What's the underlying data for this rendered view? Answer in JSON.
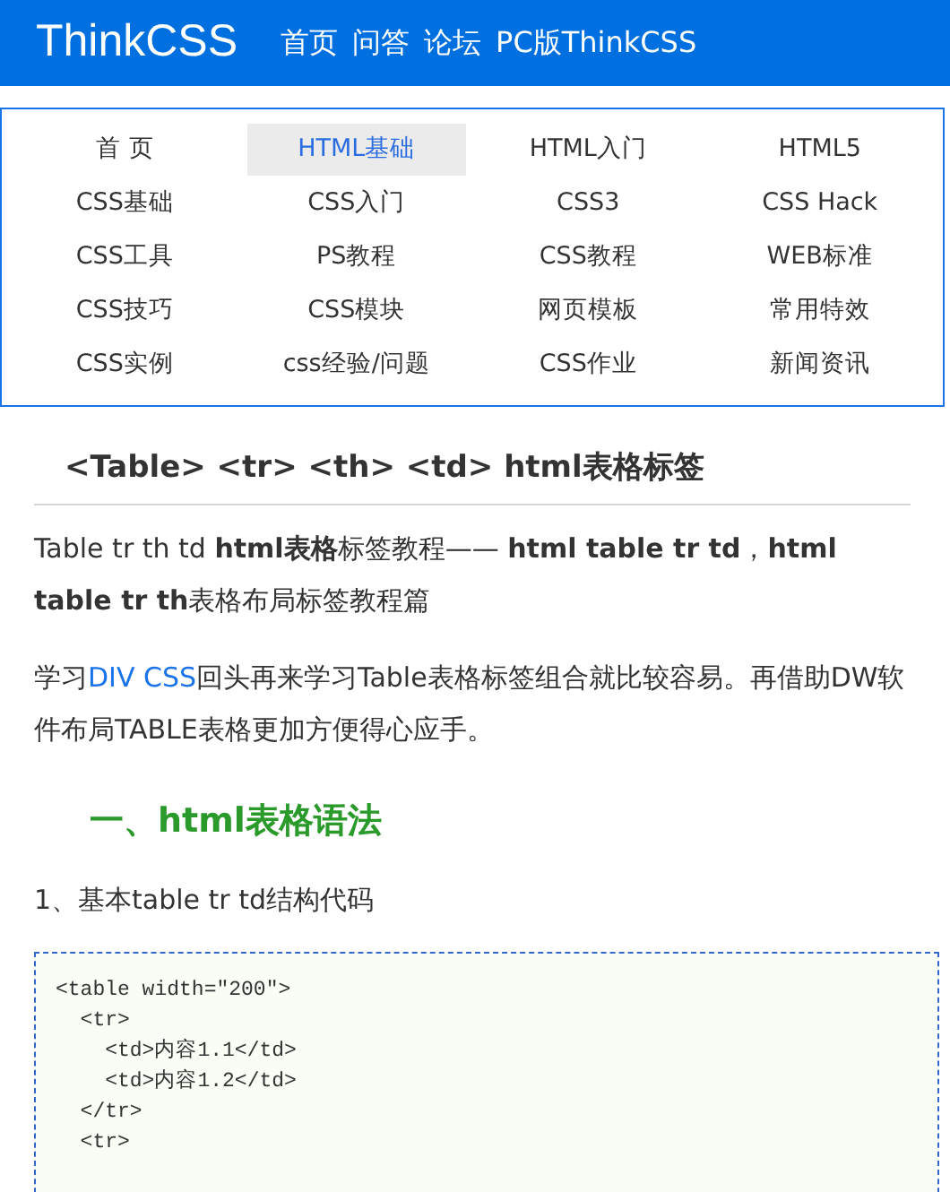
{
  "header": {
    "logo": "ThinkCSS",
    "links": [
      "首页",
      "问答",
      "论坛",
      "PC版ThinkCSS"
    ]
  },
  "category_nav": [
    {
      "label": "首 页",
      "selected": false
    },
    {
      "label": "HTML基础",
      "selected": true
    },
    {
      "label": "HTML入门",
      "selected": false
    },
    {
      "label": "HTML5",
      "selected": false
    },
    {
      "label": "CSS基础",
      "selected": false
    },
    {
      "label": "CSS入门",
      "selected": false
    },
    {
      "label": "CSS3",
      "selected": false
    },
    {
      "label": "CSS Hack",
      "selected": false
    },
    {
      "label": "CSS工具",
      "selected": false
    },
    {
      "label": "PS教程",
      "selected": false
    },
    {
      "label": "CSS教程",
      "selected": false
    },
    {
      "label": "WEB标准",
      "selected": false
    },
    {
      "label": "CSS技巧",
      "selected": false
    },
    {
      "label": "CSS模块",
      "selected": false
    },
    {
      "label": "网页模板",
      "selected": false
    },
    {
      "label": "常用特效",
      "selected": false
    },
    {
      "label": "CSS实例",
      "selected": false
    },
    {
      "label": "css经验/问题",
      "selected": false
    },
    {
      "label": "CSS作业",
      "selected": false
    },
    {
      "label": "新闻资讯",
      "selected": false
    }
  ],
  "article": {
    "title": "<Table> <tr> <th> <td> html表格标签",
    "intro": "Table tr th td **html表格**标签教程—— **html table tr td**，**html table tr th**表格布局标签教程篇",
    "paragraph": {
      "before": "学习",
      "link": "DIV CSS",
      "after": "回头再来学习Table表格标签组合就比较容易。再借助DW软件布局TABLE表格更加方便得心应手。"
    },
    "section_heading": "一、html表格语法",
    "step": "1、基本table tr td结构代码",
    "code_lines": [
      "<table width=\"200\">",
      "  <tr>",
      "    <td>内容1.1</td>",
      "    <td>内容1.2</td>",
      "  </tr>",
      "  <tr>"
    ]
  }
}
